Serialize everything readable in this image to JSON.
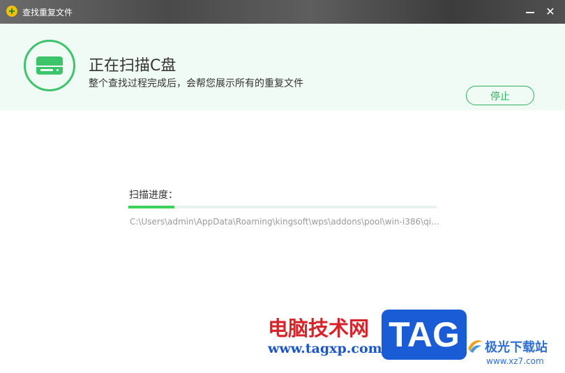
{
  "window": {
    "title": "查找重复文件",
    "minimize_label": "—",
    "close_label": "✕"
  },
  "header": {
    "title": "正在扫描C盘",
    "subtitle": "整个查找过程完成后，会帮您展示所有的重复文件",
    "stop_label": "停止"
  },
  "progress": {
    "label": "扫描进度：",
    "fraction": 0.15,
    "current_path": "C:\\Users\\admin\\AppData\\Roaming\\kingsoft\\wps\\addons\\pool\\win-i386\\qi..."
  },
  "watermark": {
    "site_cn": "电脑技术网",
    "site_url": "www.tagxp.com",
    "tag": "TAG",
    "site2_cn": "极光下载站",
    "site2_url": "www.xz7.com"
  },
  "colors": {
    "accent": "#3cc46b",
    "progress": "#3cd15a",
    "header_bg": "#f1fbf6"
  }
}
